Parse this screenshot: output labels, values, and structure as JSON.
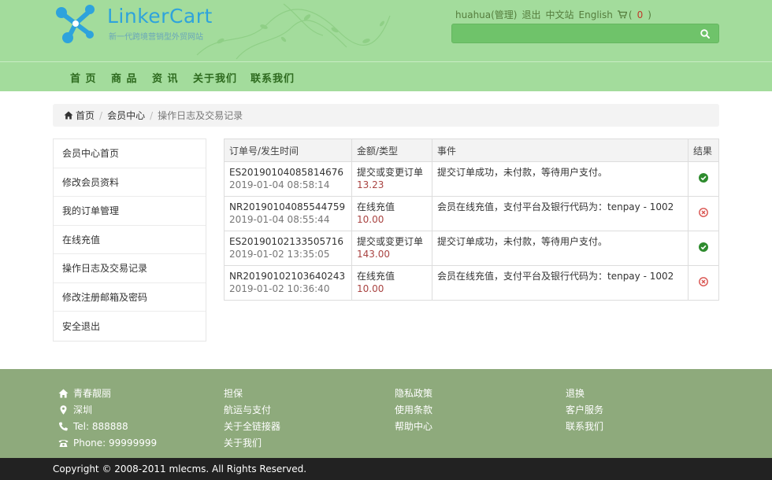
{
  "header": {
    "brand": "LinkerCart",
    "tagline": "新一代跨境营销型外贸网站",
    "user_link": "huahua(管理)",
    "logout_label": "退出",
    "lang_cn": "中文站",
    "lang_en": "English",
    "cart_open": "(",
    "cart_count": "0",
    "cart_close": ")",
    "search_placeholder": ""
  },
  "nav": [
    "首 页",
    "商 品",
    "资 讯",
    "关于我们",
    "联系我们"
  ],
  "breadcrumb": {
    "home": "首页",
    "member": "会员中心",
    "current": "操作日志及交易记录"
  },
  "sidebar": [
    "会员中心首页",
    "修改会员资料",
    "我的订单管理",
    "在线充值",
    "操作日志及交易记录",
    "修改注册邮箱及密码",
    "安全退出"
  ],
  "table": {
    "headers": [
      "订单号/发生时间",
      "金额/类型",
      "事件",
      "结果"
    ],
    "rows": [
      {
        "order": "ES20190104085814676",
        "time": "2019-01-04 08:58:14",
        "type": "提交或变更订单",
        "amount": "13.23",
        "event": "提交订单成功，未付款，等待用户支付。",
        "result": "success"
      },
      {
        "order": "NR20190104085544759",
        "time": "2019-01-04 08:55:44",
        "type": "在线充值",
        "amount": "10.00",
        "event": "会员在线充值，支付平台及银行代码为：tenpay - 1002",
        "result": "fail"
      },
      {
        "order": "ES20190102133505716",
        "time": "2019-01-02 13:35:05",
        "type": "提交或变更订单",
        "amount": "143.00",
        "event": "提交订单成功，未付款，等待用户支付。",
        "result": "success"
      },
      {
        "order": "NR20190102103640243",
        "time": "2019-01-02 10:36:40",
        "type": "在线充值",
        "amount": "10.00",
        "event": "会员在线充值，支付平台及银行代码为：tenpay - 1002",
        "result": "fail"
      }
    ]
  },
  "footer": {
    "contact": {
      "name": "青春靓丽",
      "city": "深圳",
      "tel": "Tel: 888888",
      "phone": "Phone: 99999999"
    },
    "col2": [
      "担保",
      "航运与支付",
      "关于全链接器",
      "关于我们"
    ],
    "col3": [
      "隐私政策",
      "使用条款",
      "帮助中心"
    ],
    "col4": [
      "退换",
      "客户服务",
      "联系我们"
    ],
    "copyright": "Copyright © 2008-2011 mlecms. All Rights Reserved."
  },
  "colors": {
    "header_bg": "#a3dc9c",
    "accent_logo": "#2ea3dc",
    "success": "#2e8b2e",
    "fail": "#d9534f",
    "footer_bg": "#8eaa7c",
    "copyright_bg": "#222222"
  }
}
